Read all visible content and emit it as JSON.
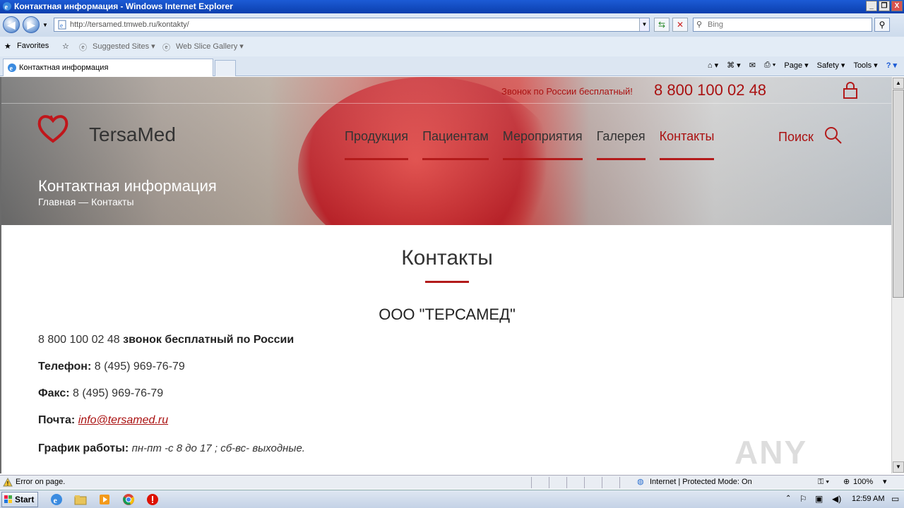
{
  "window": {
    "title": "Контактная информация - Windows Internet Explorer",
    "min_label": "_",
    "max_label": "❐",
    "close_label": "X"
  },
  "address": {
    "url": "http://tersamed.tmweb.ru/kontakty/",
    "search_placeholder": "Bing"
  },
  "favorites": {
    "favorites_label": "Favorites",
    "suggested_label": "Suggested Sites ▾",
    "webslice_label": "Web Slice Gallery ▾"
  },
  "tabs": [
    {
      "label": "Контактная информация"
    }
  ],
  "commandbar": {
    "page": "Page ▾",
    "safety": "Safety ▾",
    "tools": "Tools ▾"
  },
  "site": {
    "free_call_text": "Звонок по России бесплатный!",
    "phone": "8 800 100 02 48",
    "brand": "TersaMed",
    "nav": [
      {
        "label": "Продукция"
      },
      {
        "label": "Пациентам"
      },
      {
        "label": "Мероприятия"
      },
      {
        "label": "Галерея"
      },
      {
        "label": "Контакты"
      }
    ],
    "search_label": "Поиск",
    "page_heading": "Контактная информация",
    "breadcrumb": "Главная  —  Контакты"
  },
  "contacts": {
    "title": "Контакты",
    "company": "ООО \"ТЕРСАМЕД\"",
    "hotline_number": "8 800 100 02 48",
    "hotline_text": "звонок бесплатный по России",
    "phone_label": "Телефон:",
    "phone_value": "8 (495) 969-76-79",
    "fax_label": "Факс:",
    "fax_value": "8 (495) 969-76-79",
    "email_label": "Почта:",
    "email_value": "info@tersamed.ru",
    "hours_label": "График работы:",
    "hours_value": "пн-пт -с 8 до 17 ; сб-вс- выходные."
  },
  "statusbar": {
    "error_text": "Error on page.",
    "zone_text": "Internet | Protected Mode: On",
    "zoom_text": "100%"
  },
  "taskbar": {
    "start_label": "Start",
    "clock": "12:59 AM"
  },
  "watermark": "ANY RUN",
  "colors": {
    "accent": "#b31b1b",
    "ie_blue": "#1c5bd5"
  }
}
